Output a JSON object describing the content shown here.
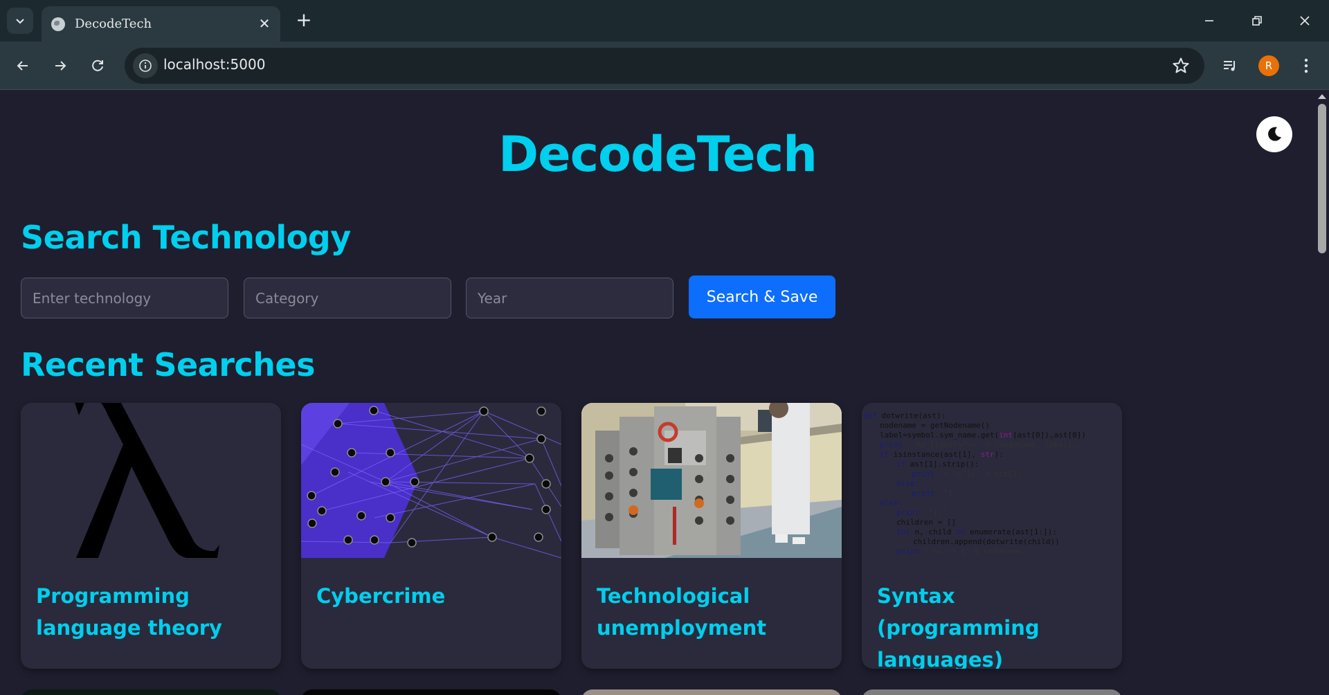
{
  "browser": {
    "tab_title": "DecodeTech",
    "url": "localhost:5000",
    "profile_initial": "R",
    "icons": {
      "tab_list": "chevron-down-icon",
      "favicon": "globe-icon",
      "close_tab": "close-icon",
      "new_tab": "plus-icon",
      "back": "arrow-left-icon",
      "forward": "arrow-right-icon",
      "reload": "reload-icon",
      "site_info": "info-icon",
      "bookmark": "star-icon",
      "media": "media-control-icon",
      "menu": "kebab-menu-icon"
    }
  },
  "page": {
    "site_title": "DecodeTech",
    "search_section_title": "Search Technology",
    "search": {
      "technology_placeholder": "Enter technology",
      "category_placeholder": "Category",
      "year_placeholder": "Year",
      "button_label": "Search & Save"
    },
    "recent_section_title": "Recent Searches",
    "recent": [
      {
        "title": "Programming language theory",
        "image": "lambda-symbol"
      },
      {
        "title": "Cybercrime",
        "image": "network-graph"
      },
      {
        "title": "Technological unemployment",
        "image": "robot-at-counter"
      },
      {
        "title": "Syntax (programming languages)",
        "image": "code-snippet"
      }
    ],
    "theme_toggle_icon": "moon-icon"
  },
  "colors": {
    "accent": "#00cfee",
    "button": "#0d6efd",
    "background": "#1e1e2e",
    "card": "#2a2a3c"
  }
}
